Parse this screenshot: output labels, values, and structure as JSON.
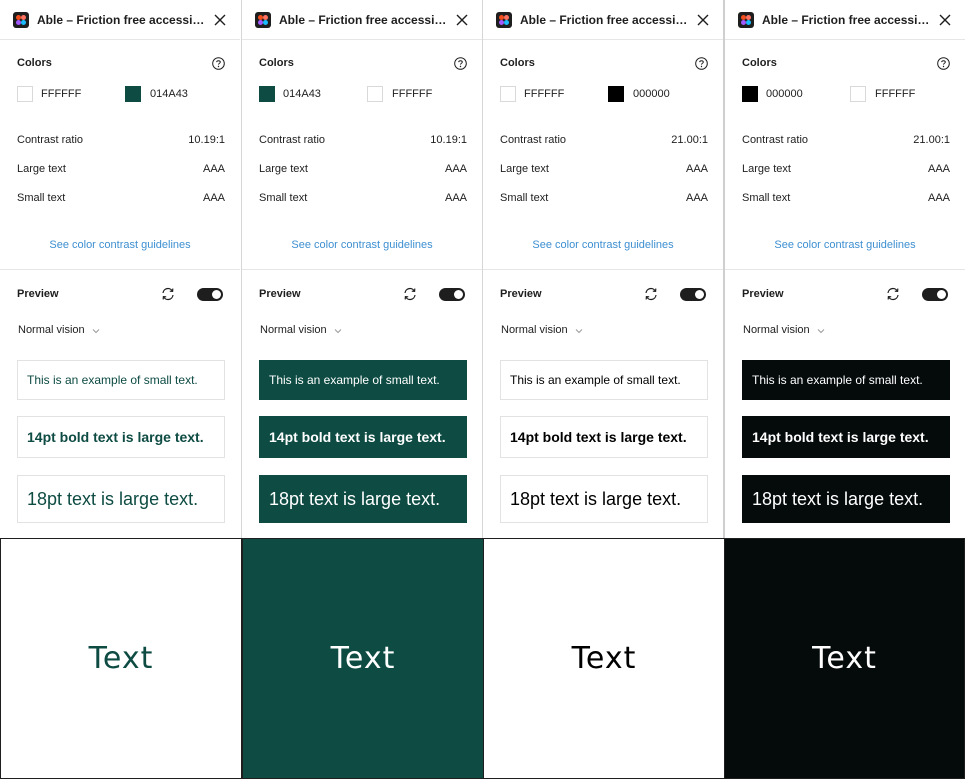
{
  "panels": [
    {
      "title": "Able – Friction free accessibility",
      "colors_heading": "Colors",
      "swatch1": {
        "hex": "FFFFFF",
        "color": "#FFFFFF"
      },
      "swatch2": {
        "hex": "014A43",
        "color": "#0D4B43"
      },
      "contrast_label": "Contrast ratio",
      "contrast_value": "10.19:1",
      "large_label": "Large text",
      "large_value": "AAA",
      "small_label": "Small text",
      "small_value": "AAA",
      "link": "See color contrast guidelines",
      "preview_heading": "Preview",
      "vision": "Normal vision",
      "samples": [
        "This is an example of small text.",
        "14pt bold text is large text.",
        "18pt text is large text."
      ],
      "preview_bg": "#FFFFFF",
      "preview_fg": "#0D4B43"
    },
    {
      "title": "Able – Friction free accessibility",
      "colors_heading": "Colors",
      "swatch1": {
        "hex": "014A43",
        "color": "#0D4B43"
      },
      "swatch2": {
        "hex": "FFFFFF",
        "color": "#FFFFFF"
      },
      "contrast_label": "Contrast ratio",
      "contrast_value": "10.19:1",
      "large_label": "Large text",
      "large_value": "AAA",
      "small_label": "Small text",
      "small_value": "AAA",
      "link": "See color contrast guidelines",
      "preview_heading": "Preview",
      "vision": "Normal vision",
      "samples": [
        "This is an example of small text.",
        "14pt bold text is large text.",
        "18pt text is large text."
      ],
      "preview_bg": "#0D4B43",
      "preview_fg": "#FFFFFF"
    },
    {
      "title": "Able – Friction free accessibility",
      "colors_heading": "Colors",
      "swatch1": {
        "hex": "FFFFFF",
        "color": "#FFFFFF"
      },
      "swatch2": {
        "hex": "000000",
        "color": "#000000"
      },
      "contrast_label": "Contrast ratio",
      "contrast_value": "21.00:1",
      "large_label": "Large text",
      "large_value": "AAA",
      "small_label": "Small text",
      "small_value": "AAA",
      "link": "See color contrast guidelines",
      "preview_heading": "Preview",
      "vision": "Normal vision",
      "samples": [
        "This is an example of small text.",
        "14pt bold text is large text.",
        "18pt text is large text."
      ],
      "preview_bg": "#FFFFFF",
      "preview_fg": "#000000"
    },
    {
      "title": "Able – Friction free accessibility",
      "colors_heading": "Colors",
      "swatch1": {
        "hex": "000000",
        "color": "#000000"
      },
      "swatch2": {
        "hex": "FFFFFF",
        "color": "#FFFFFF"
      },
      "contrast_label": "Contrast ratio",
      "contrast_value": "21.00:1",
      "large_label": "Large text",
      "large_value": "AAA",
      "small_label": "Small text",
      "small_value": "AAA",
      "link": "See color contrast guidelines",
      "preview_heading": "Preview",
      "vision": "Normal vision",
      "samples": [
        "This is an example of small text.",
        "14pt bold text is large text.",
        "18pt text is large text."
      ],
      "preview_bg": "#050A0A",
      "preview_fg": "#FFFFFF"
    }
  ],
  "bottom_samples": [
    {
      "text": "Text",
      "bg": "#FFFFFF",
      "fg": "#0D4B43"
    },
    {
      "text": "Text",
      "bg": "#0D4B43",
      "fg": "#FFFFFF"
    },
    {
      "text": "Text",
      "bg": "#FFFFFF",
      "fg": "#000000"
    },
    {
      "text": "Text",
      "bg": "#050A0A",
      "fg": "#FFFFFF"
    }
  ],
  "icons": {
    "app": "figma-app-icon",
    "close": "close-icon",
    "help": "help-circle-icon",
    "refresh": "refresh-icon",
    "toggle": "toggle-switch",
    "chevron": "chevron-down-icon"
  }
}
